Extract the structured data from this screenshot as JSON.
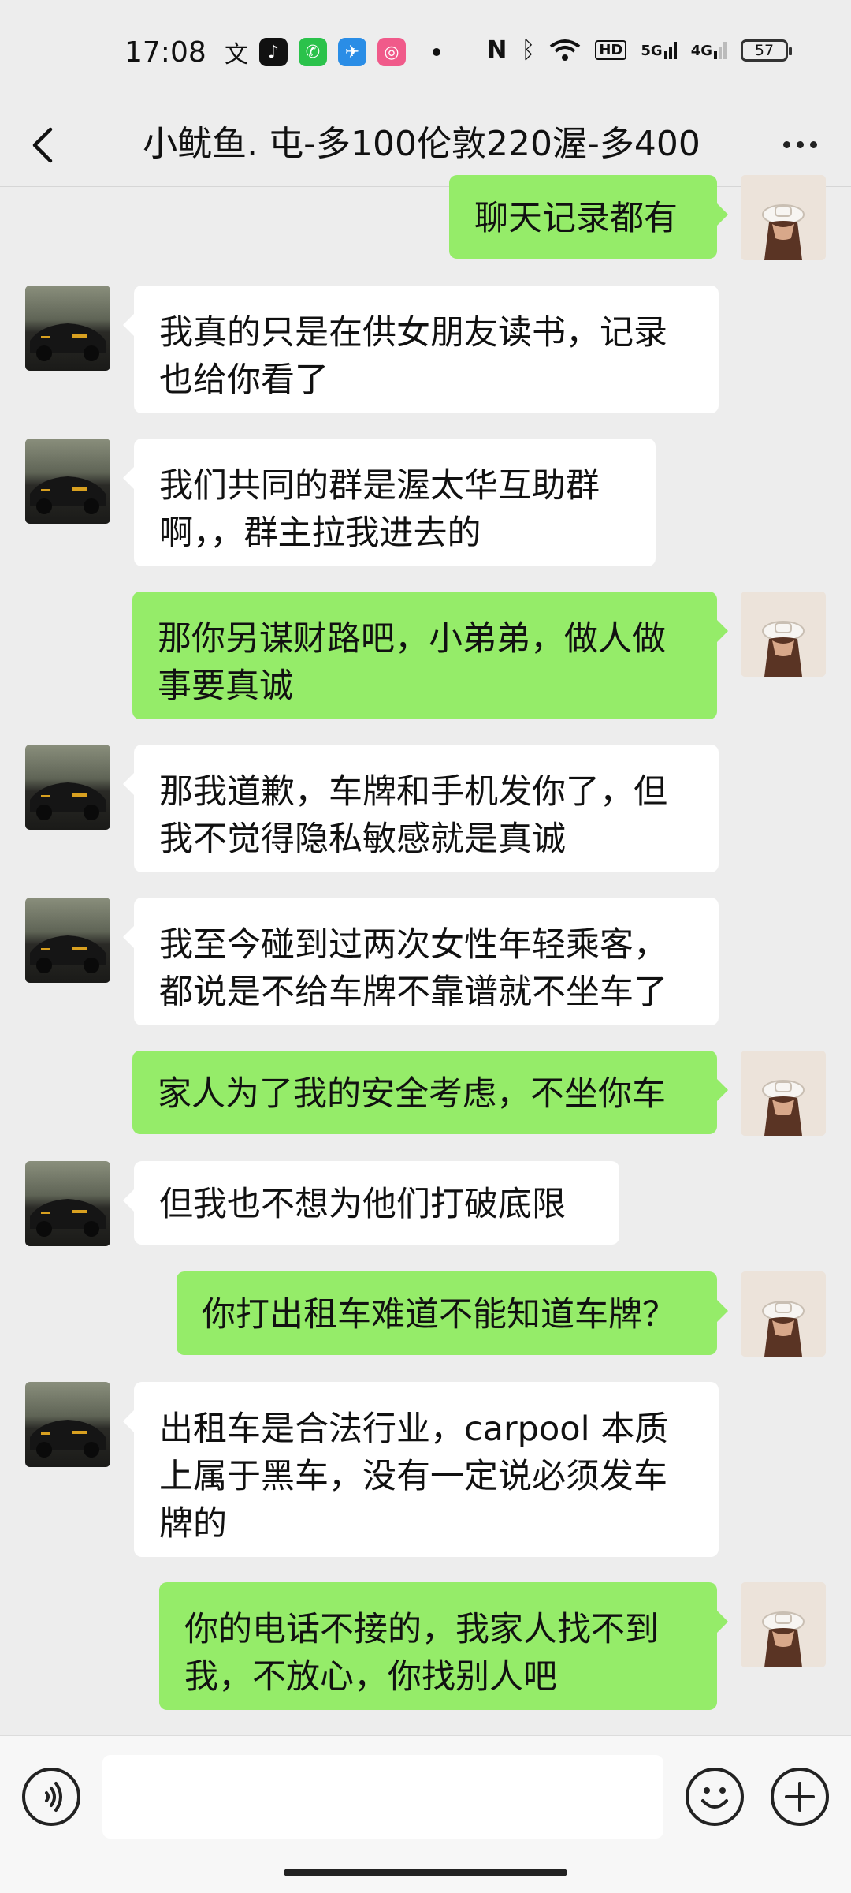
{
  "status_bar": {
    "time": "17:08",
    "network_label": "5G",
    "network_label_2": "4G",
    "hd_label": "HD",
    "battery": "57"
  },
  "header": {
    "title": "小鱿鱼. 屯-多100伦敦220渥-多400"
  },
  "messages": [
    {
      "side": "out",
      "text": "聊天记录都有"
    },
    {
      "side": "in",
      "text": "我真的只是在供女朋友读书，记录也给你看了"
    },
    {
      "side": "in",
      "text": "我们共同的群是渥太华互助群啊，，群主拉我进去的"
    },
    {
      "side": "out",
      "text": "那你另谋财路吧，小弟弟，做人做事要真诚"
    },
    {
      "side": "in",
      "text": "那我道歉，车牌和手机发你了，但我不觉得隐私敏感就是真诚"
    },
    {
      "side": "in",
      "text": "我至今碰到过两次女性年轻乘客，都说是不给车牌不靠谱就不坐车了"
    },
    {
      "side": "out",
      "text": "家人为了我的安全考虑，不坐你车"
    },
    {
      "side": "in",
      "text": "但我也不想为他们打破底限"
    },
    {
      "side": "out",
      "text": "你打出租车难道不能知道车牌？"
    },
    {
      "side": "in",
      "text": "出租车是合法行业，carpool 本质上属于黑车，没有一定说必须发车牌的"
    },
    {
      "side": "out",
      "text": "你的电话不接的，我家人找不到我，不放心，你找别人吧"
    }
  ],
  "input_bar": {
    "input_value": ""
  },
  "colors": {
    "background": "#ededed",
    "incoming_bubble": "#ffffff",
    "outgoing_bubble": "#95ec69"
  },
  "icons": {
    "back": "chevron-left-icon",
    "more": "more-dots-icon",
    "voice": "voice-icon",
    "emoji": "emoji-icon",
    "plus": "plus-icon"
  }
}
